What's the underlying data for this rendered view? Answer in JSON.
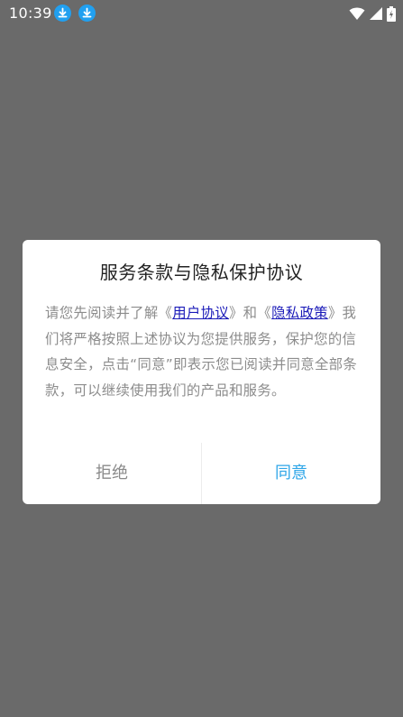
{
  "status_bar": {
    "time": "10:39",
    "icons": [
      "download-icon",
      "download-icon",
      "wifi-icon",
      "signal-icon",
      "battery-icon"
    ],
    "colors": {
      "download_badge": "#21a0f0"
    }
  },
  "dialog": {
    "title": "服务条款与隐私保护协议",
    "body": {
      "part1": "请您先阅读并了解《",
      "link1": "用户协议",
      "part2": "》和《",
      "link2": "隐私政策",
      "part3": "》我们将严格按照上述协议为您提供服务，保护您的信息安全，点击“同意”即表示您已阅读并同意全部条款，可以继续使用我们的产品和服务。"
    },
    "buttons": {
      "reject": "拒绝",
      "agree": "同意"
    },
    "colors": {
      "link": "#1a1ab8",
      "agree": "#2ea6e8",
      "reject": "#8a8a8a"
    }
  }
}
